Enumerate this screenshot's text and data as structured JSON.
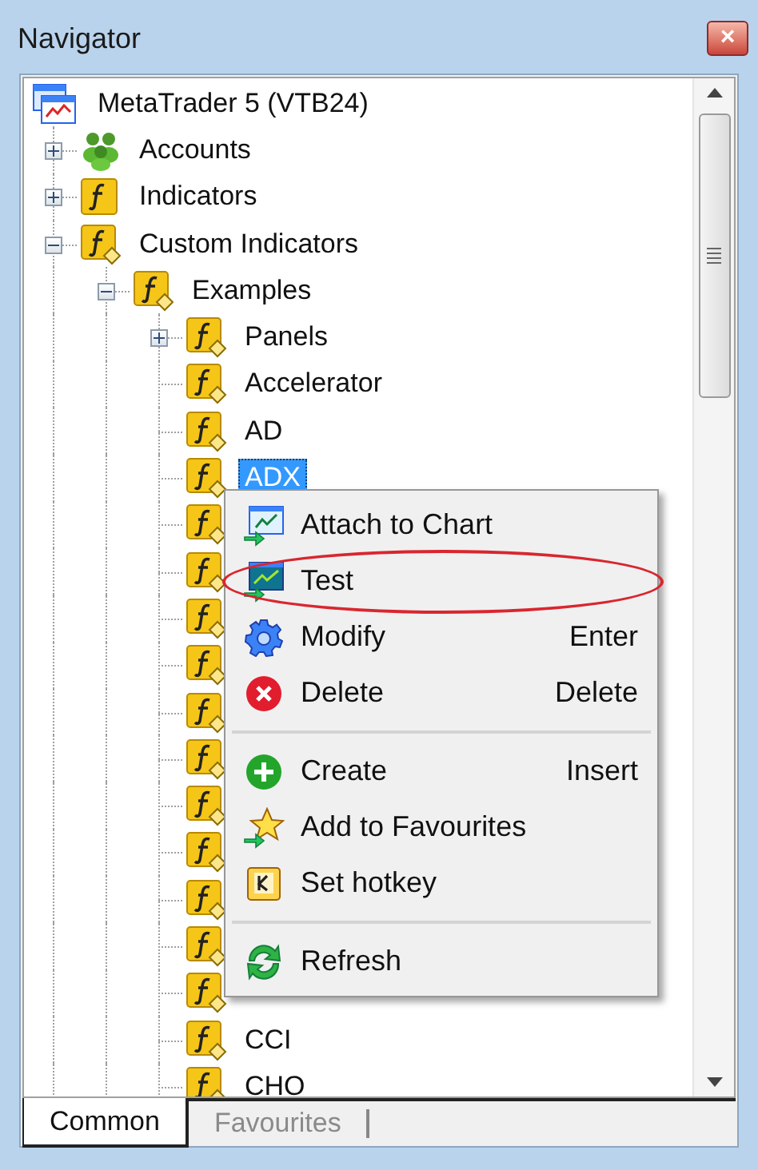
{
  "window": {
    "title": "Navigator",
    "close": "×"
  },
  "tree": {
    "label": "MetaTrader 5 (VTB24)",
    "kind": "terminal",
    "selected": false,
    "children": [
      {
        "label": "Accounts",
        "kind": "accounts",
        "expanded": false,
        "selected": false
      },
      {
        "label": "Indicators",
        "kind": "function",
        "expanded": false,
        "selected": false
      },
      {
        "label": "Custom Indicators",
        "kind": "custom",
        "expanded": true,
        "selected": false,
        "children": [
          {
            "label": "Examples",
            "kind": "custom",
            "expanded": true,
            "selected": false,
            "children": [
              {
                "label": "Panels",
                "kind": "custom",
                "expanded": false,
                "selected": false
              },
              {
                "label": "Accelerator",
                "kind": "custom",
                "selected": false
              },
              {
                "label": "AD",
                "kind": "custom",
                "selected": false
              },
              {
                "label": "ADX",
                "kind": "custom",
                "selected": true
              },
              {
                "kind": "custom"
              },
              {
                "kind": "custom"
              },
              {
                "kind": "custom"
              },
              {
                "kind": "custom"
              },
              {
                "kind": "custom"
              },
              {
                "kind": "custom"
              },
              {
                "kind": "custom"
              },
              {
                "kind": "custom"
              },
              {
                "kind": "custom"
              },
              {
                "kind": "custom"
              },
              {
                "kind": "custom"
              },
              {
                "label": "CCI",
                "kind": "custom",
                "selected": false
              },
              {
                "label": "CHO",
                "kind": "custom",
                "selected": false
              }
            ]
          }
        ]
      }
    ]
  },
  "context_menu": [
    {
      "kind": "attach",
      "label": "Attach to Chart",
      "circled": false
    },
    {
      "kind": "test",
      "label": "Test",
      "circled": true
    },
    {
      "kind": "gear",
      "label": "Modify",
      "shortcut": "Enter",
      "circled": false
    },
    {
      "kind": "delete",
      "label": "Delete",
      "shortcut": "Delete",
      "circled": false
    },
    {
      "kind": "separator"
    },
    {
      "kind": "create",
      "label": "Create",
      "shortcut": "Insert",
      "circled": false
    },
    {
      "kind": "star",
      "label": "Add to Favourites",
      "circled": false
    },
    {
      "kind": "hotkey",
      "label": "Set hotkey",
      "circled": false
    },
    {
      "kind": "separator"
    },
    {
      "kind": "refresh",
      "label": "Refresh",
      "circled": false
    }
  ],
  "tabs": [
    {
      "label": "Common",
      "selected": true
    },
    {
      "label": "Favourites",
      "selected": false
    }
  ]
}
